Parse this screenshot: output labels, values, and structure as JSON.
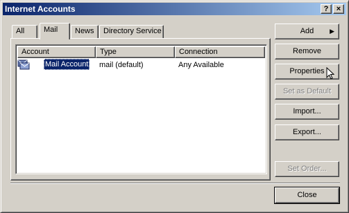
{
  "window": {
    "title": "Internet Accounts",
    "help_label": "?",
    "close_label": "×"
  },
  "tabs": [
    {
      "label": "All",
      "active": false
    },
    {
      "label": "Mail",
      "active": true
    },
    {
      "label": "News",
      "active": false
    },
    {
      "label": "Directory Service",
      "active": false
    }
  ],
  "list": {
    "columns": [
      "Account",
      "Type",
      "Connection"
    ],
    "rows": [
      {
        "account": "Mail Account",
        "type": "mail (default)",
        "connection": "Any Available",
        "selected": true
      }
    ]
  },
  "buttons": {
    "add": {
      "label": "Add",
      "arrow": "▶"
    },
    "remove": {
      "label": "Remove"
    },
    "properties": {
      "label": "Properties"
    },
    "set_default": {
      "label": "Set as Default",
      "enabled": false
    },
    "import": {
      "label": "Import..."
    },
    "export": {
      "label": "Export..."
    },
    "set_order": {
      "label": "Set Order...",
      "enabled": false
    },
    "close": {
      "label": "Close"
    }
  },
  "icons": {
    "account_icon": "mail-account-icon",
    "cursor": "arrow-cursor-icon"
  }
}
